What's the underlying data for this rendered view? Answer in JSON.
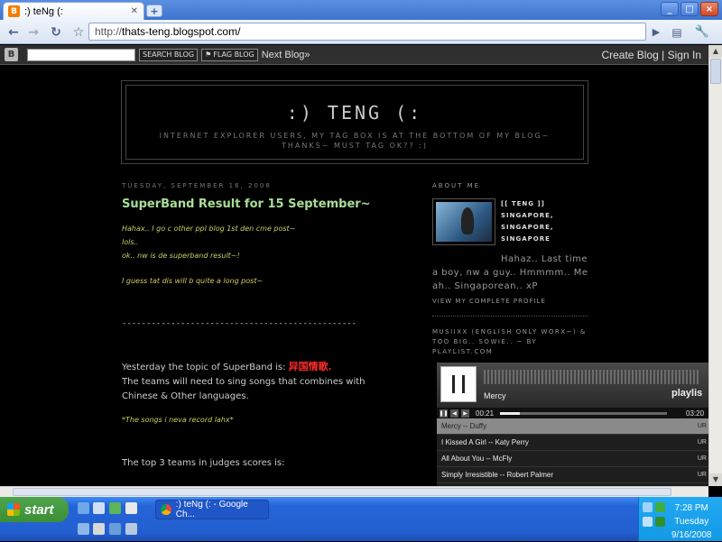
{
  "browser": {
    "tab_title": ":) teNg (:",
    "tab_favicon_letter": "B",
    "new_tab_symbol": "+",
    "window_buttons": [
      "_",
      "□",
      "×"
    ],
    "address_prefix": "http://",
    "address_host": "thats-teng.blogspot.com/"
  },
  "blogger_nav": {
    "search_button": "SEARCH BLOG",
    "flag_button": "FLAG BLOG",
    "next_blog": "Next Blog»",
    "create_blog": "Create Blog",
    "separator": "|",
    "sign_in": "Sign In"
  },
  "blog": {
    "title": ":) TENG (:",
    "description": "INTERNET EXPLORER USERS, MY TAG BOX IS AT THE BOTTOM OF MY BLOG~ THANKS~ MUST TAG OK?? :)"
  },
  "post": {
    "date": "TUESDAY, SEPTEMBER 16, 2008",
    "title": "SuperBand Result for 15 September~",
    "yellow_lines": [
      "Hahax.. I go c other ppl blog 1st den cme post~",
      "lols..",
      "ok.. nw is de superband result~!"
    ],
    "yellow_line_4": "I guess tat dis will b quite a long post~",
    "divider": "------------------------------------------------",
    "topic_prefix": "Yesterday the topic of SuperBand is: ",
    "topic_red": "异国情歌.",
    "topic_body": "The teams will need to sing songs that combines with Chinese & Other languages.",
    "songs_note": "*The songs i neva record lahx*",
    "top3": "The top 3 teams in judges scores is:"
  },
  "sidebar": {
    "about_heading": "ABOUT ME",
    "profile_name": "[[ TENG ]]",
    "profile_loc1": "SINGAPORE,",
    "profile_loc2": "SINGAPORE,",
    "profile_loc3": "SINGAPORE",
    "about_text": "Hahaz.. Last time a boy, nw a guy.. Hmmmm.. Me ah.. Singaporean.. xP",
    "view_profile": "VIEW MY COMPLETE PROFILE",
    "music_heading": "MUSIIXX (ENGLISH ONLY WORX~) & TOO BIG.. SOWIE.. ~ BY PLAYLIST.COM"
  },
  "player": {
    "current_song": "Mercy",
    "logo": "playlis",
    "time": "00:21",
    "duration": "03:20",
    "progress": 0.12,
    "tracks": [
      {
        "title": "Mercy -- Duffy",
        "tag": "UR",
        "active": true
      },
      {
        "title": "I Kissed A Girl -- Katy Perry",
        "tag": "UR",
        "active": false
      },
      {
        "title": "All About You -- McFly",
        "tag": "UR",
        "active": false
      },
      {
        "title": "Simply Irresistible -- Robert Palmer",
        "tag": "UR",
        "active": false
      }
    ]
  },
  "taskbar": {
    "start": "start",
    "task_label": ":) teNg (: - Google Ch...",
    "time": "7:28 PM",
    "day": "Tuesday",
    "date": "9/16/2008"
  },
  "colors": {
    "post_title": "#aadd99",
    "highlight_red": "#ff2a2a",
    "italic_yellow": "#cccc66",
    "taskbar_blue": "#235fd0",
    "start_green": "#3b8f36"
  }
}
